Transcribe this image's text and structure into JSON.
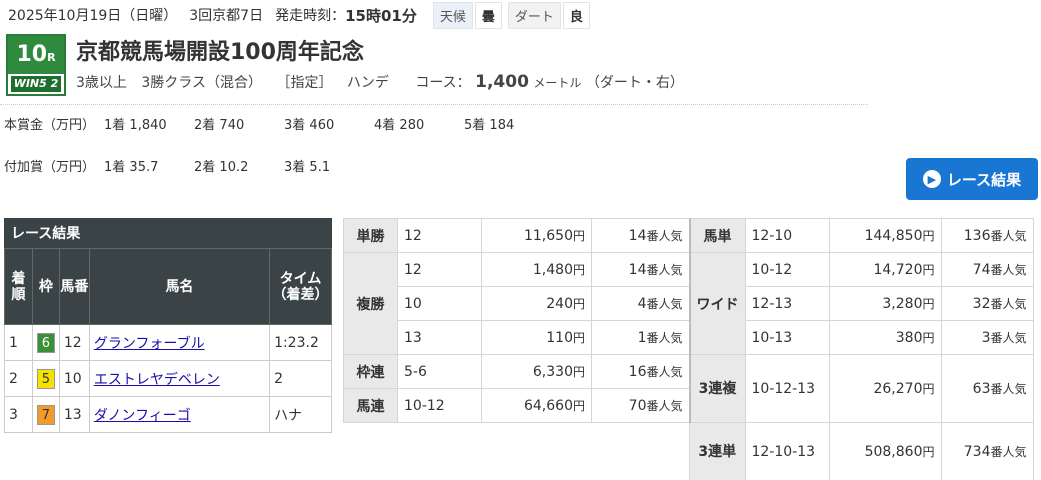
{
  "header": {
    "date": "2025年10月19日（日曜）",
    "meeting": "3回京都7日",
    "start_label": "発走時刻：",
    "start_time": "15時01分",
    "weather_label": "天候",
    "weather_value": "曇",
    "track_label": "ダート",
    "track_value": "良"
  },
  "badge": {
    "race_number": "10",
    "race_suffix": "R",
    "win5": "WIN5 2"
  },
  "race": {
    "title": "京都競馬場開設100周年記念",
    "age": "3歳以上",
    "class": "3勝クラス（混合）",
    "designation": "［指定］",
    "weight": "ハンデ",
    "course_label": "コース：",
    "course_distance": "1,400",
    "course_unit": "メートル",
    "course_surface": "（ダート・右）"
  },
  "prize": {
    "main_label": "本賞金（万円）",
    "main": [
      {
        "rank": "1着",
        "value": "1,840"
      },
      {
        "rank": "2着",
        "value": "740"
      },
      {
        "rank": "3着",
        "value": "460"
      },
      {
        "rank": "4着",
        "value": "280"
      },
      {
        "rank": "5着",
        "value": "184"
      }
    ],
    "extra_label": "付加賞（万円）",
    "extra": [
      {
        "rank": "1着",
        "value": "35.7"
      },
      {
        "rank": "2着",
        "value": "10.2"
      },
      {
        "rank": "3着",
        "value": "5.1"
      }
    ]
  },
  "results_button": "レース結果",
  "results": {
    "caption": "レース結果",
    "headers": [
      "着順",
      "枠",
      "馬番",
      "馬名",
      "タイム（着差）"
    ],
    "rows": [
      {
        "place": "1",
        "waku": "6",
        "waku_color": "#3a8f3a",
        "waku_text": "#ffffff",
        "num": "12",
        "name": "グランフォーブル",
        "time": "1:23.2"
      },
      {
        "place": "2",
        "waku": "5",
        "waku_color": "#f5e200",
        "waku_text": "#333333",
        "num": "10",
        "name": "エストレヤデベレン",
        "time": "2"
      },
      {
        "place": "3",
        "waku": "7",
        "waku_color": "#f39a2d",
        "waku_text": "#333333",
        "num": "13",
        "name": "ダノンフィーゴ",
        "time": "ハナ"
      }
    ]
  },
  "payouts": {
    "yen": "円",
    "pop_suffix": "番人気",
    "tansho": {
      "kind": "単勝",
      "combo": "12",
      "amount": "11,650",
      "pop": "14"
    },
    "fukusho": {
      "kind": "複勝",
      "rows": [
        {
          "combo": "12",
          "amount": "1,480",
          "pop": "14"
        },
        {
          "combo": "10",
          "amount": "240",
          "pop": "4"
        },
        {
          "combo": "13",
          "amount": "110",
          "pop": "1"
        }
      ]
    },
    "wakuren": {
      "kind": "枠連",
      "combo": "5-6",
      "amount": "6,330",
      "pop": "16"
    },
    "umaren": {
      "kind": "馬連",
      "combo": "10-12",
      "amount": "64,660",
      "pop": "70"
    },
    "umatan": {
      "kind": "馬単",
      "combo": "12-10",
      "amount": "144,850",
      "pop": "136"
    },
    "wide": {
      "kind": "ワイド",
      "rows": [
        {
          "combo": "10-12",
          "amount": "14,720",
          "pop": "74"
        },
        {
          "combo": "12-13",
          "amount": "3,280",
          "pop": "32"
        },
        {
          "combo": "10-13",
          "amount": "380",
          "pop": "3"
        }
      ]
    },
    "sanrenpuku": {
      "kind": "3連複",
      "combo": "10-12-13",
      "amount": "26,270",
      "pop": "63"
    },
    "sanrentan": {
      "kind": "3連単",
      "combo": "12-10-13",
      "amount": "508,860",
      "pop": "734"
    }
  }
}
